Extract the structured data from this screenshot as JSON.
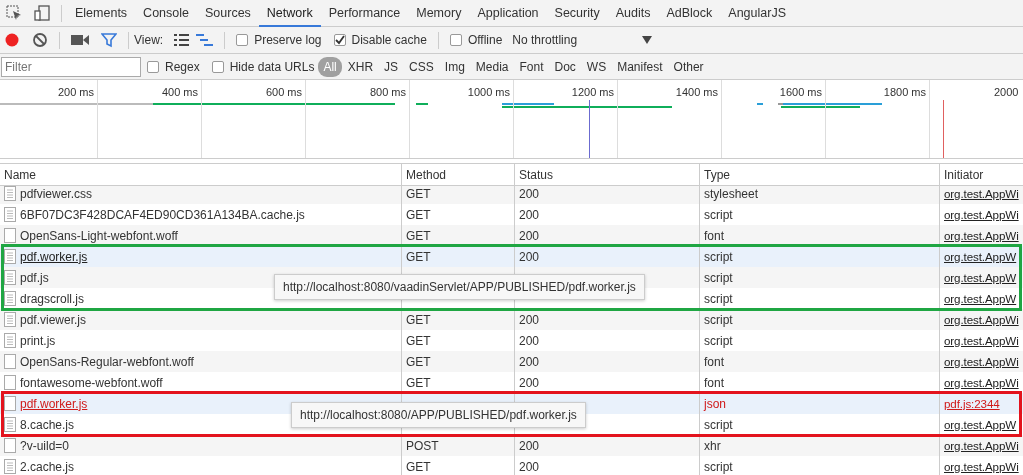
{
  "tabs": [
    {
      "label": "Elements",
      "selected": false
    },
    {
      "label": "Console",
      "selected": false
    },
    {
      "label": "Sources",
      "selected": false
    },
    {
      "label": "Network",
      "selected": true
    },
    {
      "label": "Performance",
      "selected": false
    },
    {
      "label": "Memory",
      "selected": false
    },
    {
      "label": "Application",
      "selected": false
    },
    {
      "label": "Security",
      "selected": false
    },
    {
      "label": "Audits",
      "selected": false
    },
    {
      "label": "AdBlock",
      "selected": false
    },
    {
      "label": "AngularJS",
      "selected": false
    }
  ],
  "toolbar": {
    "recording": true,
    "filter_on": true,
    "view_label": "View:",
    "views": [
      {
        "kind": "list",
        "selected": false
      },
      {
        "kind": "waterfall",
        "selected": true
      }
    ],
    "options": [
      {
        "label": "Preserve log",
        "checked": false
      },
      {
        "label": "Disable cache",
        "checked": true
      },
      {
        "label": "Offline",
        "checked": false
      }
    ],
    "throttling": "No throttling"
  },
  "filter_bar": {
    "placeholder": "Filter",
    "options": [
      {
        "label": "Regex",
        "checked": false
      },
      {
        "label": "Hide data URLs",
        "checked": false
      }
    ],
    "types": [
      {
        "label": "All",
        "selected": true
      },
      {
        "label": "XHR",
        "selected": false
      },
      {
        "label": "JS",
        "selected": false
      },
      {
        "label": "CSS",
        "selected": false
      },
      {
        "label": "Img",
        "selected": false
      },
      {
        "label": "Media",
        "selected": false
      },
      {
        "label": "Font",
        "selected": false
      },
      {
        "label": "Doc",
        "selected": false
      },
      {
        "label": "WS",
        "selected": false
      },
      {
        "label": "Manifest",
        "selected": false
      },
      {
        "label": "Other",
        "selected": false
      }
    ]
  },
  "timeline": {
    "ticks": [
      "200 ms",
      "400 ms",
      "600 ms",
      "800 ms",
      "1000 ms",
      "1200 ms",
      "1400 ms",
      "1600 ms",
      "1800 ms",
      "2000"
    ]
  },
  "columns": [
    "Name",
    "Method",
    "Status",
    "Type",
    "Initiator"
  ],
  "rows": [
    {
      "kind": "document",
      "name": "pdfviewer.css",
      "method": "GET",
      "status": "200",
      "type": "stylesheet",
      "initiator": "org.test.AppWi",
      "highlighted": false,
      "error": false
    },
    {
      "kind": "document",
      "name": "6BF07DC3F428DCAF4ED90CD361A134BA.cache.js",
      "method": "GET",
      "status": "200",
      "type": "script",
      "initiator": "org.test.AppWi",
      "highlighted": false,
      "error": false
    },
    {
      "kind": "blank",
      "name": "OpenSans-Light-webfont.woff",
      "method": "GET",
      "status": "200",
      "type": "font",
      "initiator": "org.test.AppWi",
      "highlighted": false,
      "error": false
    },
    {
      "kind": "document",
      "name": "pdf.worker.js",
      "method": "GET",
      "status": "200",
      "type": "script",
      "initiator": "org.test.AppW",
      "highlighted": true,
      "error": false,
      "color": "#1fa643",
      "tooltip": "http://localhost:8080/vaadinServlet/APP/PUBLISHED/pdf.worker.js"
    },
    {
      "kind": "document",
      "name": "pdf.js",
      "type": "script",
      "initiator": "org.test.AppW",
      "highlighted": false,
      "error": false,
      "color": "#1fa643"
    },
    {
      "kind": "document",
      "name": "dragscroll.js",
      "type": "script",
      "initiator": "org.test.AppW",
      "highlighted": false,
      "error": false,
      "color": "#1fa643"
    },
    {
      "kind": "document",
      "name": "pdf.viewer.js",
      "method": "GET",
      "status": "200",
      "type": "script",
      "initiator": "org.test.AppWi",
      "highlighted": false,
      "error": false
    },
    {
      "kind": "document",
      "name": "print.js",
      "method": "GET",
      "status": "200",
      "type": "script",
      "initiator": "org.test.AppWi",
      "highlighted": false,
      "error": false
    },
    {
      "kind": "blank",
      "name": "OpenSans-Regular-webfont.woff",
      "method": "GET",
      "status": "200",
      "type": "font",
      "initiator": "org.test.AppWi",
      "highlighted": false,
      "error": false
    },
    {
      "kind": "blank",
      "name": "fontawesome-webfont.woff",
      "method": "GET",
      "status": "200",
      "type": "font",
      "initiator": "org.test.AppWi",
      "highlighted": false,
      "error": false
    },
    {
      "kind": "blank",
      "name": "pdf.worker.js",
      "type": "json",
      "initiator": "pdf.js:2344",
      "highlighted": true,
      "error": true,
      "color": "#e3131d",
      "tooltip": "http://localhost:8080/APP/PUBLISHED/pdf.worker.js"
    },
    {
      "kind": "document",
      "name": "8.cache.js",
      "type": "script",
      "initiator": "org.test.AppW",
      "highlighted": false,
      "error": false,
      "color": "#e3131d"
    },
    {
      "kind": "blank",
      "name": "?v-uild=0",
      "method": "POST",
      "status": "200",
      "type": "xhr",
      "initiator": "org.test.AppWi",
      "highlighted": false,
      "error": false
    },
    {
      "kind": "document",
      "name": "2.cache.js",
      "method": "GET",
      "status": "200",
      "type": "script",
      "initiator": "org.test.AppWi",
      "highlighted": false,
      "error": false
    }
  ]
}
